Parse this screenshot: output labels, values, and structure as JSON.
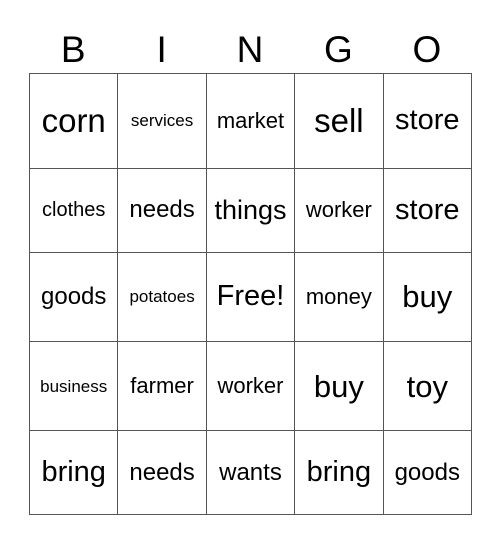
{
  "header": [
    "B",
    "I",
    "N",
    "G",
    "O"
  ],
  "grid": [
    [
      "corn",
      "services",
      "market",
      "sell",
      "store"
    ],
    [
      "clothes",
      "needs",
      "things",
      "worker",
      "store"
    ],
    [
      "goods",
      "potatoes",
      "Free!",
      "money",
      "buy"
    ],
    [
      "business",
      "farmer",
      "worker",
      "buy",
      "toy"
    ],
    [
      "bring",
      "needs",
      "wants",
      "bring",
      "goods"
    ]
  ]
}
